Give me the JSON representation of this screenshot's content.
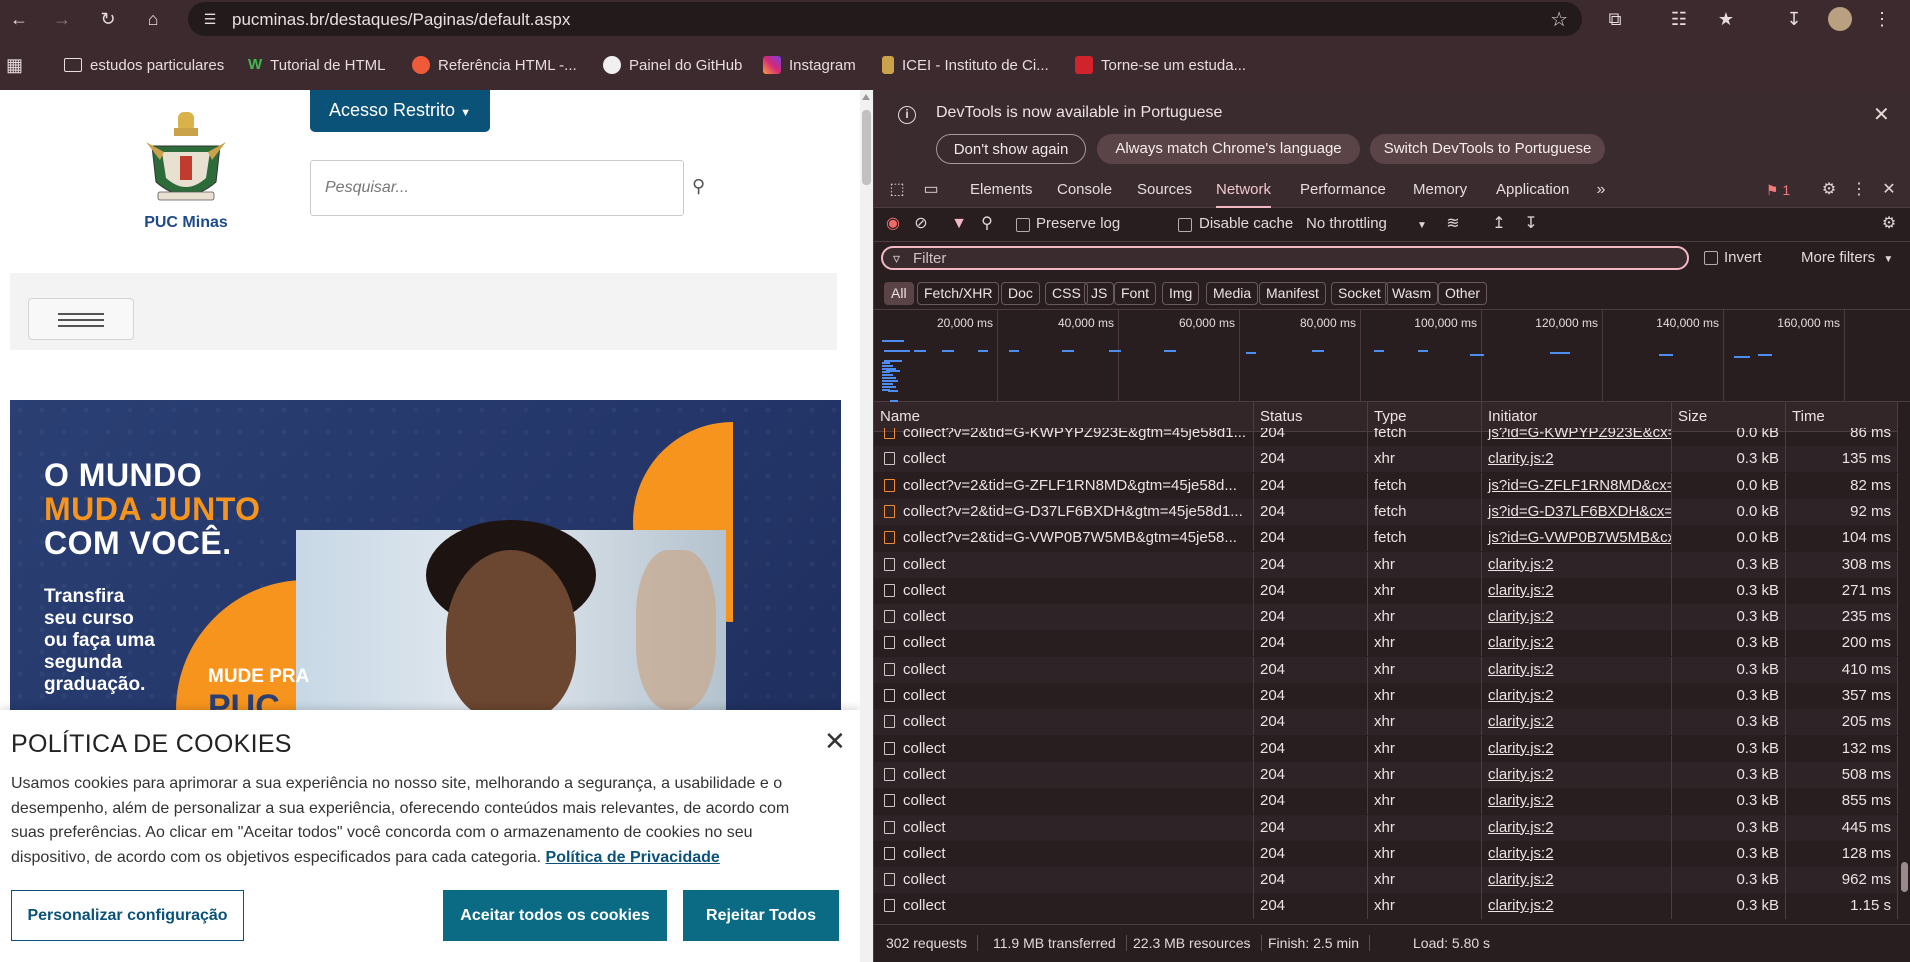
{
  "browser": {
    "url": "pucminas.br/destaques/Paginas/default.aspx",
    "bookmarks": [
      {
        "label": "estudos particulares",
        "icon": "folder-icon"
      },
      {
        "label": "Tutorial de HTML",
        "icon": "w3schools-icon"
      },
      {
        "label": "Referência HTML -...",
        "icon": "mdn-icon"
      },
      {
        "label": "Painel do GitHub",
        "icon": "github-icon"
      },
      {
        "label": "Instagram",
        "icon": "instagram-icon"
      },
      {
        "label": "ICEI - Instituto de Ci...",
        "icon": "icei-icon"
      },
      {
        "label": "Torne-se um estuda...",
        "icon": "bookmark-red-icon"
      }
    ]
  },
  "page": {
    "brand": "PUC Minas",
    "acesso_label": "Acesso Restrito",
    "search_placeholder": "Pesquisar...",
    "banner": {
      "line1": "O MUNDO",
      "line2": "MUDA JUNTO",
      "line3": "COM VOCÊ.",
      "sub1": "Transfira",
      "sub2": "seu curso",
      "sub3": "ou faça uma",
      "sub4": "segunda",
      "sub5": "graduação.",
      "mude": "MUDE PRA",
      "puc": "PUC"
    },
    "cookie": {
      "title": "POLÍTICA DE COOKIES",
      "text": "Usamos cookies para aprimorar a sua experiência no nosso site, melhorando a segurança, a usabilidade e o desempenho, além de personalizar a sua experiência, oferecendo conteúdos mais relevantes, de acordo com suas preferências. Ao clicar em \"Aceitar todos\" você concorda com o armazenamento de cookies no seu dispositivo, de acordo com os objetivos especificados para cada categoria.",
      "link": "Política de Privacidade",
      "btn_customize": "Personalizar configuração",
      "btn_accept": "Aceitar todos os cookies",
      "btn_reject": "Rejeitar Todos"
    }
  },
  "devtools": {
    "infobar": {
      "message": "DevTools is now available in Portuguese",
      "btn_dont_show": "Don't show again",
      "btn_match": "Always match Chrome's language",
      "btn_switch": "Switch DevTools to Portuguese"
    },
    "tabs": [
      "Elements",
      "Console",
      "Sources",
      "Network",
      "Performance",
      "Memory",
      "Application"
    ],
    "active_tab": "Network",
    "issues_count": "1",
    "toolbar": {
      "preserve_log": "Preserve log",
      "disable_cache": "Disable cache",
      "throttling": "No throttling"
    },
    "filter_placeholder": "Filter",
    "invert_label": "Invert",
    "more_filters": "More filters",
    "types": [
      "All",
      "Fetch/XHR",
      "Doc",
      "CSS",
      "JS",
      "Font",
      "Img",
      "Media",
      "Manifest",
      "Socket",
      "Wasm",
      "Other"
    ],
    "overview_ticks": [
      "20,000 ms",
      "40,000 ms",
      "60,000 ms",
      "80,000 ms",
      "100,000 ms",
      "120,000 ms",
      "140,000 ms",
      "160,000 ms"
    ],
    "columns": [
      "Name",
      "Status",
      "Type",
      "Initiator",
      "Size",
      "Time"
    ],
    "rows": [
      {
        "name": "collect?v=2&tid=G-KWPYPZ923E&gtm=45je58d1...",
        "status": "204",
        "type": "fetch",
        "initiator": "js?id=G-KWPYPZ923E&cx=c",
        "size": "0.0 kB",
        "time": "86 ms",
        "kind": "fetch"
      },
      {
        "name": "collect",
        "status": "204",
        "type": "xhr",
        "initiator": "clarity.js:2",
        "size": "0.3 kB",
        "time": "135 ms",
        "kind": "doc"
      },
      {
        "name": "collect?v=2&tid=G-ZFLF1RN8MD&gtm=45je58d...",
        "status": "204",
        "type": "fetch",
        "initiator": "js?id=G-ZFLF1RN8MD&cx=",
        "size": "0.0 kB",
        "time": "82 ms",
        "kind": "fetch"
      },
      {
        "name": "collect?v=2&tid=G-D37LF6BXDH&gtm=45je58d1...",
        "status": "204",
        "type": "fetch",
        "initiator": "js?id=G-D37LF6BXDH&cx=c",
        "size": "0.0 kB",
        "time": "92 ms",
        "kind": "fetch"
      },
      {
        "name": "collect?v=2&tid=G-VWP0B7W5MB&gtm=45je58...",
        "status": "204",
        "type": "fetch",
        "initiator": "js?id=G-VWP0B7W5MB&cx",
        "size": "0.0 kB",
        "time": "104 ms",
        "kind": "fetch"
      },
      {
        "name": "collect",
        "status": "204",
        "type": "xhr",
        "initiator": "clarity.js:2",
        "size": "0.3 kB",
        "time": "308 ms",
        "kind": "doc"
      },
      {
        "name": "collect",
        "status": "204",
        "type": "xhr",
        "initiator": "clarity.js:2",
        "size": "0.3 kB",
        "time": "271 ms",
        "kind": "doc"
      },
      {
        "name": "collect",
        "status": "204",
        "type": "xhr",
        "initiator": "clarity.js:2",
        "size": "0.3 kB",
        "time": "235 ms",
        "kind": "doc"
      },
      {
        "name": "collect",
        "status": "204",
        "type": "xhr",
        "initiator": "clarity.js:2",
        "size": "0.3 kB",
        "time": "200 ms",
        "kind": "doc"
      },
      {
        "name": "collect",
        "status": "204",
        "type": "xhr",
        "initiator": "clarity.js:2",
        "size": "0.3 kB",
        "time": "410 ms",
        "kind": "doc"
      },
      {
        "name": "collect",
        "status": "204",
        "type": "xhr",
        "initiator": "clarity.js:2",
        "size": "0.3 kB",
        "time": "357 ms",
        "kind": "doc"
      },
      {
        "name": "collect",
        "status": "204",
        "type": "xhr",
        "initiator": "clarity.js:2",
        "size": "0.3 kB",
        "time": "205 ms",
        "kind": "doc"
      },
      {
        "name": "collect",
        "status": "204",
        "type": "xhr",
        "initiator": "clarity.js:2",
        "size": "0.3 kB",
        "time": "132 ms",
        "kind": "doc"
      },
      {
        "name": "collect",
        "status": "204",
        "type": "xhr",
        "initiator": "clarity.js:2",
        "size": "0.3 kB",
        "time": "508 ms",
        "kind": "doc"
      },
      {
        "name": "collect",
        "status": "204",
        "type": "xhr",
        "initiator": "clarity.js:2",
        "size": "0.3 kB",
        "time": "855 ms",
        "kind": "doc"
      },
      {
        "name": "collect",
        "status": "204",
        "type": "xhr",
        "initiator": "clarity.js:2",
        "size": "0.3 kB",
        "time": "445 ms",
        "kind": "doc"
      },
      {
        "name": "collect",
        "status": "204",
        "type": "xhr",
        "initiator": "clarity.js:2",
        "size": "0.3 kB",
        "time": "128 ms",
        "kind": "doc"
      },
      {
        "name": "collect",
        "status": "204",
        "type": "xhr",
        "initiator": "clarity.js:2",
        "size": "0.3 kB",
        "time": "962 ms",
        "kind": "doc"
      },
      {
        "name": "collect",
        "status": "204",
        "type": "xhr",
        "initiator": "clarity.js:2",
        "size": "0.3 kB",
        "time": "1.15 s",
        "kind": "doc"
      }
    ],
    "status": {
      "requests": "302 requests",
      "transferred": "11.9 MB transferred",
      "resources": "22.3 MB resources",
      "finish": "Finish: 2.5 min",
      "load": "Load: 5.80 s"
    }
  }
}
